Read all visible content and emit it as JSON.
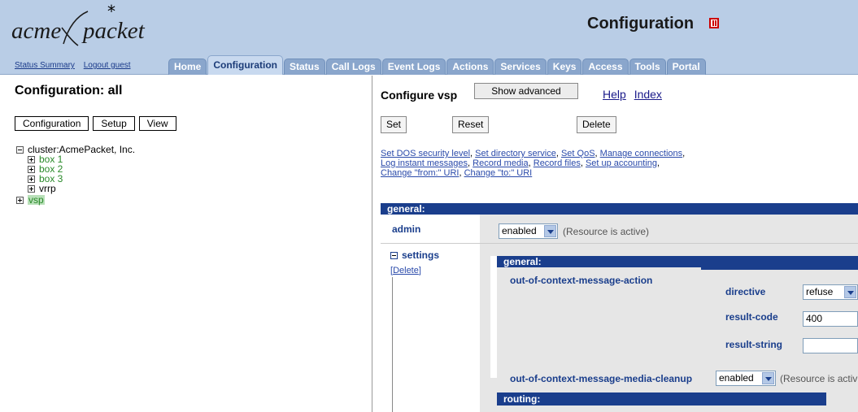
{
  "header": {
    "logo_left": "acme",
    "logo_right": "packet",
    "logo_star": "*",
    "links": [
      "Status Summary",
      "Logout guest"
    ],
    "title": "Configuration",
    "tabs": [
      "Home",
      "Configuration",
      "Status",
      "Call Logs",
      "Event Logs",
      "Actions",
      "Services",
      "Keys",
      "Access",
      "Tools",
      "Portal"
    ],
    "active_tab": "Configuration"
  },
  "left": {
    "title": "Configuration: all",
    "buttons": [
      "Configuration",
      "Setup",
      "View"
    ],
    "tree": {
      "root": "cluster:AcmePacket, Inc.",
      "children": [
        "box 1",
        "box 2",
        "box 3",
        "vrrp"
      ],
      "sibling": "vsp"
    }
  },
  "right": {
    "title": "Configure vsp",
    "show_advanced": "Show advanced",
    "help": "Help",
    "index": "Index",
    "set": "Set",
    "reset": "Reset",
    "delete": "Delete",
    "quick_links": [
      "Set DOS security level",
      "Set directory service",
      "Set QoS",
      "Manage connections",
      "Log instant messages",
      "Record media",
      "Record files",
      "Set up accounting",
      "Change \"from:\" URI",
      "Change \"to:\" URI"
    ],
    "section_general": "general:",
    "admin_label": "admin",
    "admin_value": "enabled",
    "admin_note": "(Resource is active)",
    "settings_label": "settings",
    "settings_delete": "Delete",
    "inner_general": "general:",
    "ooc_action_label": "out-of-context-message-action",
    "directive_label": "directive",
    "directive_value": "refuse",
    "result_code_label": "result-code",
    "result_code_value": "400",
    "result_string_label": "result-string",
    "result_string_value": "",
    "ooc_media_label": "out-of-context-message-media-cleanup",
    "ooc_media_value": "enabled",
    "ooc_media_note": "(Resource is activ",
    "routing": "routing:"
  }
}
